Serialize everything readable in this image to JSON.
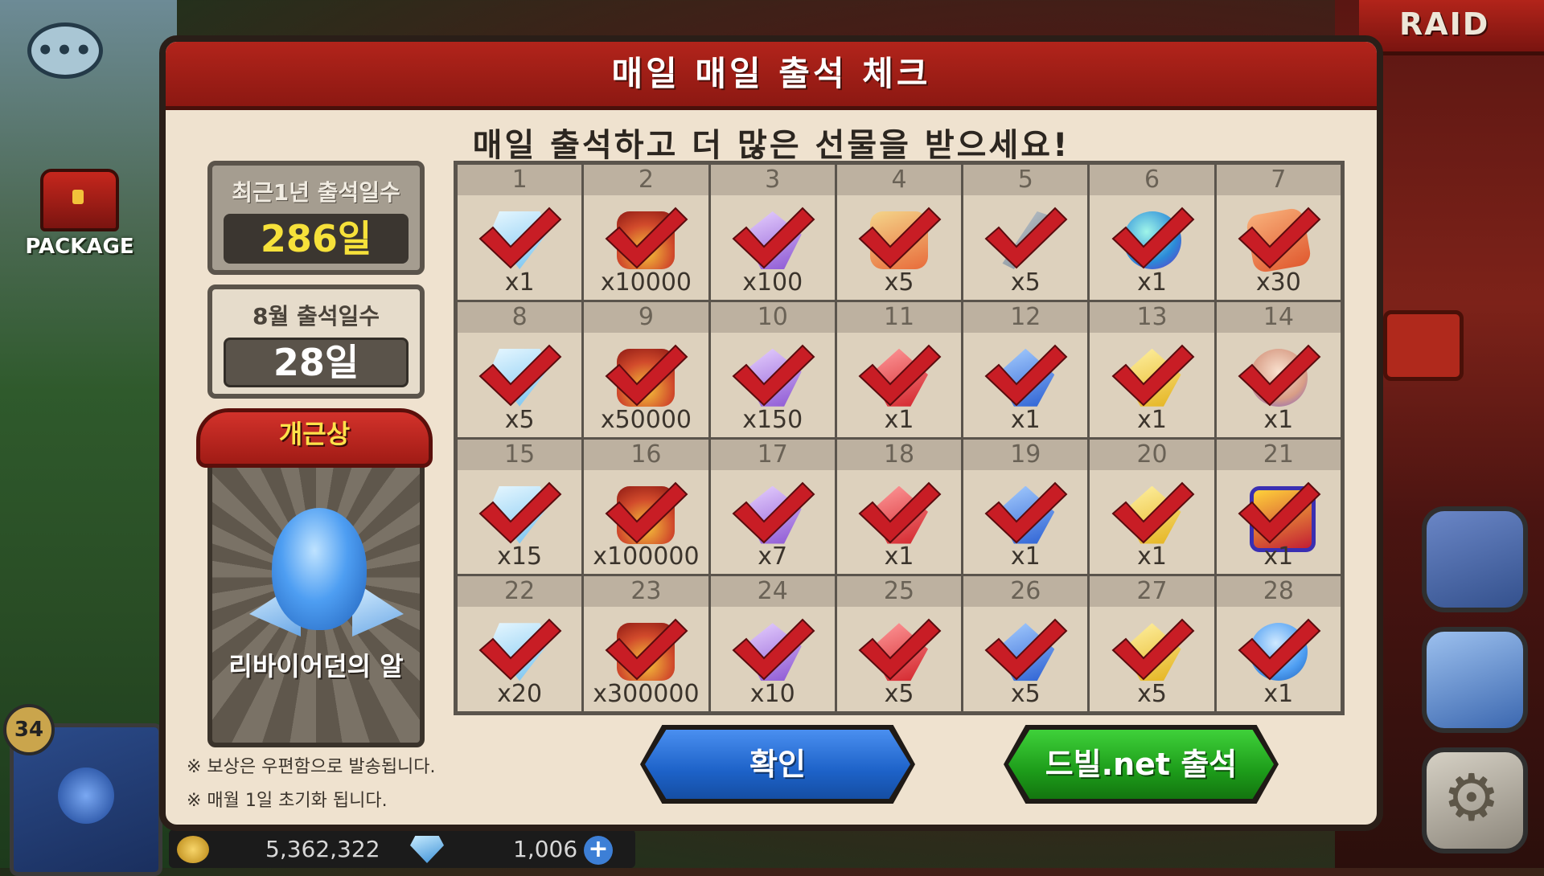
{
  "hud": {
    "package_label": "PACKAGE",
    "level": "34",
    "gold": "5,362,322",
    "gems": "1,006",
    "raid_label": "RAID"
  },
  "dialog": {
    "title": "매일 매일 출석 체크",
    "subtitle": "매일 출석하고 더 많은 선물을 받으세요!",
    "yearly": {
      "label": "최근1년 출석일수",
      "value": "286일"
    },
    "monthly": {
      "label": "8월 출석일수",
      "value": "28일"
    },
    "perfect": {
      "ribbon": "개근상",
      "reward_name": "리바이어던의 알"
    },
    "notes": [
      "※ 보상은 우편함으로 발송됩니다.",
      "※ 매월 1일 초기화 됩니다."
    ],
    "buttons": {
      "confirm": "확인",
      "dvil": "드빌.net 출석"
    },
    "days": [
      {
        "day": "1",
        "qty": "x1",
        "item": "diamond",
        "checked": true
      },
      {
        "day": "2",
        "qty": "x10000",
        "item": "gold",
        "checked": true
      },
      {
        "day": "3",
        "qty": "x100",
        "item": "amethyst",
        "checked": true
      },
      {
        "day": "4",
        "qty": "x5",
        "item": "scroll",
        "checked": true
      },
      {
        "day": "5",
        "qty": "x5",
        "item": "sword",
        "checked": true
      },
      {
        "day": "6",
        "qty": "x1",
        "item": "orb",
        "checked": true
      },
      {
        "day": "7",
        "qty": "x30",
        "item": "ticket",
        "checked": true
      },
      {
        "day": "8",
        "qty": "x5",
        "item": "diamond",
        "checked": true
      },
      {
        "day": "9",
        "qty": "x50000",
        "item": "gold",
        "checked": true
      },
      {
        "day": "10",
        "qty": "x150",
        "item": "amethyst",
        "checked": true
      },
      {
        "day": "11",
        "qty": "x1",
        "item": "red-gem",
        "checked": true
      },
      {
        "day": "12",
        "qty": "x1",
        "item": "blue-gem",
        "checked": true
      },
      {
        "day": "13",
        "qty": "x1",
        "item": "yellow-gem",
        "checked": true
      },
      {
        "day": "14",
        "qty": "x1",
        "item": "pet",
        "checked": true
      },
      {
        "day": "15",
        "qty": "x15",
        "item": "diamond",
        "checked": true
      },
      {
        "day": "16",
        "qty": "x100000",
        "item": "gold",
        "checked": true
      },
      {
        "day": "17",
        "qty": "x7",
        "item": "amethyst",
        "checked": true
      },
      {
        "day": "18",
        "qty": "x1",
        "item": "red-gem",
        "checked": true
      },
      {
        "day": "19",
        "qty": "x1",
        "item": "blue-gem",
        "checked": true
      },
      {
        "day": "20",
        "qty": "x1",
        "item": "yellow-gem",
        "checked": true
      },
      {
        "day": "21",
        "qty": "x1",
        "item": "hexbox",
        "checked": true
      },
      {
        "day": "22",
        "qty": "x20",
        "item": "diamond",
        "checked": true
      },
      {
        "day": "23",
        "qty": "x300000",
        "item": "gold",
        "checked": true
      },
      {
        "day": "24",
        "qty": "x10",
        "item": "amethyst",
        "checked": true
      },
      {
        "day": "25",
        "qty": "x5",
        "item": "red-gem glow-red",
        "checked": true
      },
      {
        "day": "26",
        "qty": "x5",
        "item": "blue-gem glow-blue",
        "checked": true
      },
      {
        "day": "27",
        "qty": "x5",
        "item": "yellow-gem glow-yellow",
        "checked": true
      },
      {
        "day": "28",
        "qty": "x1",
        "item": "blue-egg",
        "checked": true
      }
    ]
  },
  "colors": {
    "header_red": "#b2241b",
    "check_red": "#c81d25",
    "confirm_blue": "#1d62c8",
    "dvil_green": "#1d9c1a",
    "highlight_yellow": "#f6e13a"
  }
}
